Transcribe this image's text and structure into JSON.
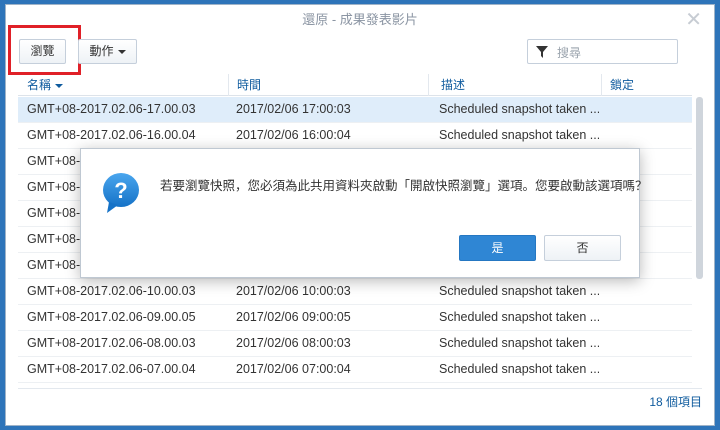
{
  "window": {
    "title": "還原 - 成果發表影片",
    "close_icon": "close-icon"
  },
  "toolbar": {
    "browse_label": "瀏覽",
    "action_label": "動作",
    "search_placeholder": "搜尋",
    "highlight_color": "#e02028"
  },
  "table": {
    "columns": [
      {
        "label": "名稱",
        "sorted": "descending"
      },
      {
        "label": "時間"
      },
      {
        "label": "描述"
      },
      {
        "label": "鎖定"
      }
    ],
    "rows": [
      {
        "name": "GMT+08-2017.02.06-17.00.03",
        "time": "2017/02/06 17:00:03",
        "desc": "Scheduled snapshot taken ...",
        "selected": true
      },
      {
        "name": "GMT+08-2017.02.06-16.00.04",
        "time": "2017/02/06 16:00:04",
        "desc": "Scheduled snapshot taken ..."
      },
      {
        "name": "GMT+08-",
        "time": "",
        "desc": ""
      },
      {
        "name": "GMT+08-",
        "time": "",
        "desc": ""
      },
      {
        "name": "GMT+08-",
        "time": "",
        "desc": ""
      },
      {
        "name": "GMT+08-",
        "time": "",
        "desc": ""
      },
      {
        "name": "GMT+08-",
        "time": "",
        "desc": ""
      },
      {
        "name": "GMT+08-2017.02.06-10.00.03",
        "time": "2017/02/06 10:00:03",
        "desc": "Scheduled snapshot taken ..."
      },
      {
        "name": "GMT+08-2017.02.06-09.00.05",
        "time": "2017/02/06 09:00:05",
        "desc": "Scheduled snapshot taken ..."
      },
      {
        "name": "GMT+08-2017.02.06-08.00.03",
        "time": "2017/02/06 08:00:03",
        "desc": "Scheduled snapshot taken ..."
      },
      {
        "name": "GMT+08-2017.02.06-07.00.04",
        "time": "2017/02/06 07:00:04",
        "desc": "Scheduled snapshot taken ..."
      }
    ]
  },
  "footer": {
    "count": "18 個項目"
  },
  "dialog": {
    "icon": "question-icon",
    "message": "若要瀏覽快照，您必須為此共用資料夾啟動「開啟快照瀏覽」選項。您要啟動該選項嗎？",
    "yes_label": "是",
    "no_label": "否"
  },
  "colors": {
    "desktop": "#2e74b9",
    "accent": "#2f86d4",
    "link": "#0f5b9e",
    "selected_row": "#dfedfa"
  }
}
